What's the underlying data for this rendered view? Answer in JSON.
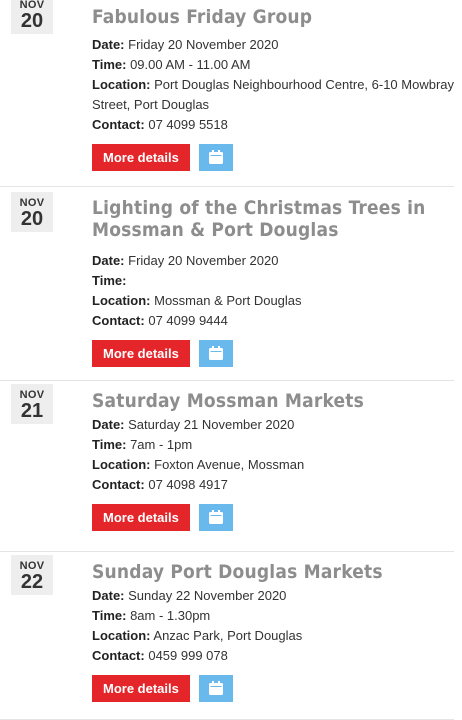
{
  "events": [
    {
      "month": "NOV",
      "day": "20",
      "title": "Fabulous Friday Group",
      "date_label": "Date:",
      "date": "Friday 20 November 2020",
      "time_label": "Time:",
      "time": "09.00 AM - 11.00 AM",
      "location_label": "Location:",
      "location": "Port Douglas Neighbourhood Centre, 6-10 Mowbray Street, Port Douglas",
      "contact_label": "Contact:",
      "contact": "07 4099 5518",
      "more_label": "More details",
      "calendar_icon": "calendar-icon"
    },
    {
      "month": "NOV",
      "day": "20",
      "title": "Lighting of the Christmas Trees in Mossman & Port Douglas",
      "date_label": "Date:",
      "date": "Friday 20 November 2020",
      "time_label": "Time:",
      "time": "",
      "location_label": "Location:",
      "location": "Mossman & Port Douglas",
      "contact_label": "Contact:",
      "contact": "07 4099 9444",
      "more_label": "More details",
      "calendar_icon": "calendar-icon"
    },
    {
      "month": "NOV",
      "day": "21",
      "title": "Saturday Mossman Markets",
      "date_label": "Date:",
      "date": "Saturday 21 November 2020",
      "time_label": "Time:",
      "time": "7am - 1pm",
      "location_label": "Location:",
      "location": "Foxton Avenue, Mossman",
      "contact_label": "Contact:",
      "contact": "07 4098 4917",
      "more_label": "More details",
      "calendar_icon": "calendar-icon"
    },
    {
      "month": "NOV",
      "day": "22",
      "title": "Sunday Port Douglas Markets",
      "date_label": "Date:",
      "date": "Sunday 22 November 2020",
      "time_label": "Time:",
      "time": "8am - 1.30pm",
      "location_label": "Location:",
      "location": "Anzac Park, Port Douglas",
      "contact_label": "Contact:",
      "contact": "0459 999 078",
      "more_label": "More details",
      "calendar_icon": "calendar-icon"
    }
  ],
  "colors": {
    "more_button": "#e4262b",
    "calendar_button": "#69b9ec",
    "title": "#8d8d8d",
    "date_box": "#eeeeee"
  }
}
